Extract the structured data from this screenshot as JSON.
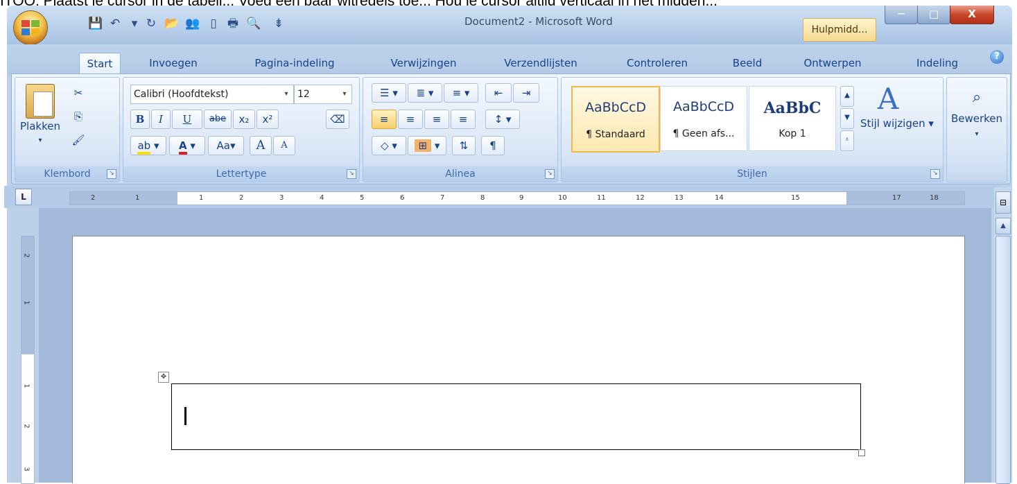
{
  "instruction": "ITOO: Plaatst je cursor in de tabeli... Voeg een paar witregels toe... Hou je cursor altijd verticaal in het midden...",
  "window": {
    "title": "Document2 - Microsoft Word",
    "help_tab": "Hulpmidd...",
    "controls": {
      "minimize": "─",
      "maximize": "□",
      "close": "X"
    }
  },
  "quick_access": [
    "save-icon",
    "undo-icon",
    "redo-icon",
    "open-icon",
    "share-icon",
    "new-icon",
    "print-icon",
    "preview-icon",
    "customize-icon"
  ],
  "tabs": [
    {
      "label": "Start",
      "active": true
    },
    {
      "label": "Invoegen"
    },
    {
      "label": "Pagina-indeling"
    },
    {
      "label": "Verwijzingen"
    },
    {
      "label": "Verzendlijsten"
    },
    {
      "label": "Controleren"
    },
    {
      "label": "Beeld"
    },
    {
      "label": "Ontwerpen"
    },
    {
      "label": "Indeling"
    }
  ],
  "ribbon": {
    "klembord": {
      "label": "Klembord",
      "paste": "Plakken"
    },
    "lettertype": {
      "label": "Lettertype",
      "font": "Calibri (Hoofdtekst)",
      "size": "12",
      "bold": "B",
      "italic": "I",
      "underline": "U",
      "strike": "abe",
      "sub": "x₂",
      "sup": "x²",
      "case": "Aa",
      "grow": "A",
      "shrink": "A"
    },
    "alinea": {
      "label": "Alinea"
    },
    "stijlen": {
      "label": "Stijlen",
      "styles": [
        {
          "sample": "AaBbCcD",
          "name": "¶ Standaard"
        },
        {
          "sample": "AaBbCcD",
          "name": "¶ Geen afs..."
        },
        {
          "sample": "AaBbC",
          "name": "Kop 1"
        }
      ],
      "change": "Stijl wijzigen"
    },
    "bewerken": {
      "label": "Bewerken"
    }
  },
  "ruler": {
    "tab_selector": "L",
    "h_numbers": [
      "2",
      "1",
      "1",
      "2",
      "3",
      "4",
      "5",
      "6",
      "7",
      "8",
      "9",
      "10",
      "11",
      "12",
      "13",
      "14",
      "15",
      "17",
      "18"
    ],
    "v_numbers": [
      "2",
      "1",
      "1",
      "2",
      "3"
    ]
  }
}
